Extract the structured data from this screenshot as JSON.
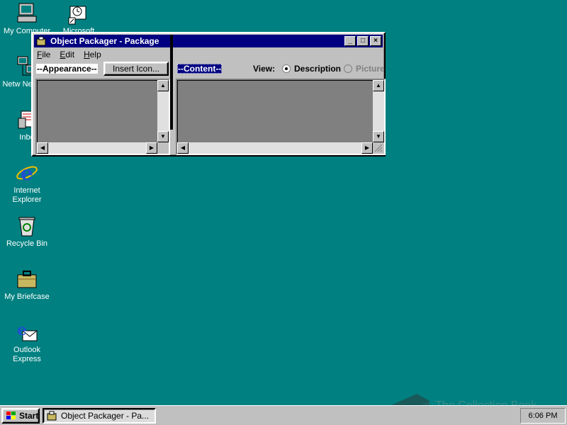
{
  "desktop": {
    "icons": [
      {
        "label": "My Computer",
        "icon": "my-computer-icon"
      },
      {
        "label": "Microsoft",
        "icon": "microsoft-icon"
      },
      {
        "label": "Netw Neighbo",
        "icon": "network-neighborhood-icon"
      },
      {
        "label": "Inbo",
        "icon": "inbox-icon"
      },
      {
        "label": "Internet Explorer",
        "icon": "internet-explorer-icon"
      },
      {
        "label": "Recycle Bin",
        "icon": "recycle-bin-icon"
      },
      {
        "label": "My Briefcase",
        "icon": "briefcase-icon"
      },
      {
        "label": "Outlook Express",
        "icon": "outlook-express-icon"
      }
    ],
    "background_color": "#008080"
  },
  "window": {
    "title": "Object Packager - Package",
    "controls": {
      "minimize": "_",
      "maximize": "□",
      "close": "×"
    },
    "menu": [
      {
        "label": "File",
        "accel": "F",
        "rest": "ile"
      },
      {
        "label": "Edit",
        "accel": "E",
        "rest": "dit"
      },
      {
        "label": "Help",
        "accel": "H",
        "rest": "elp"
      }
    ],
    "appearance_label": "--Appearance--",
    "insert_icon_label": "Insert Icon...",
    "content_label": "--Content--",
    "view_label": "View:",
    "view_options": [
      {
        "label": "Description",
        "selected": true,
        "enabled": true
      },
      {
        "label": "Picture",
        "selected": false,
        "enabled": false
      }
    ]
  },
  "taskbar": {
    "start_label": "Start",
    "task_label": "Object Packager - Pa...",
    "clock": "6:06 PM"
  },
  "watermark": {
    "text": "The Collection Book"
  },
  "colors": {
    "titlebar": "#000080",
    "face": "#c0c0c0",
    "pane": "#808080"
  }
}
